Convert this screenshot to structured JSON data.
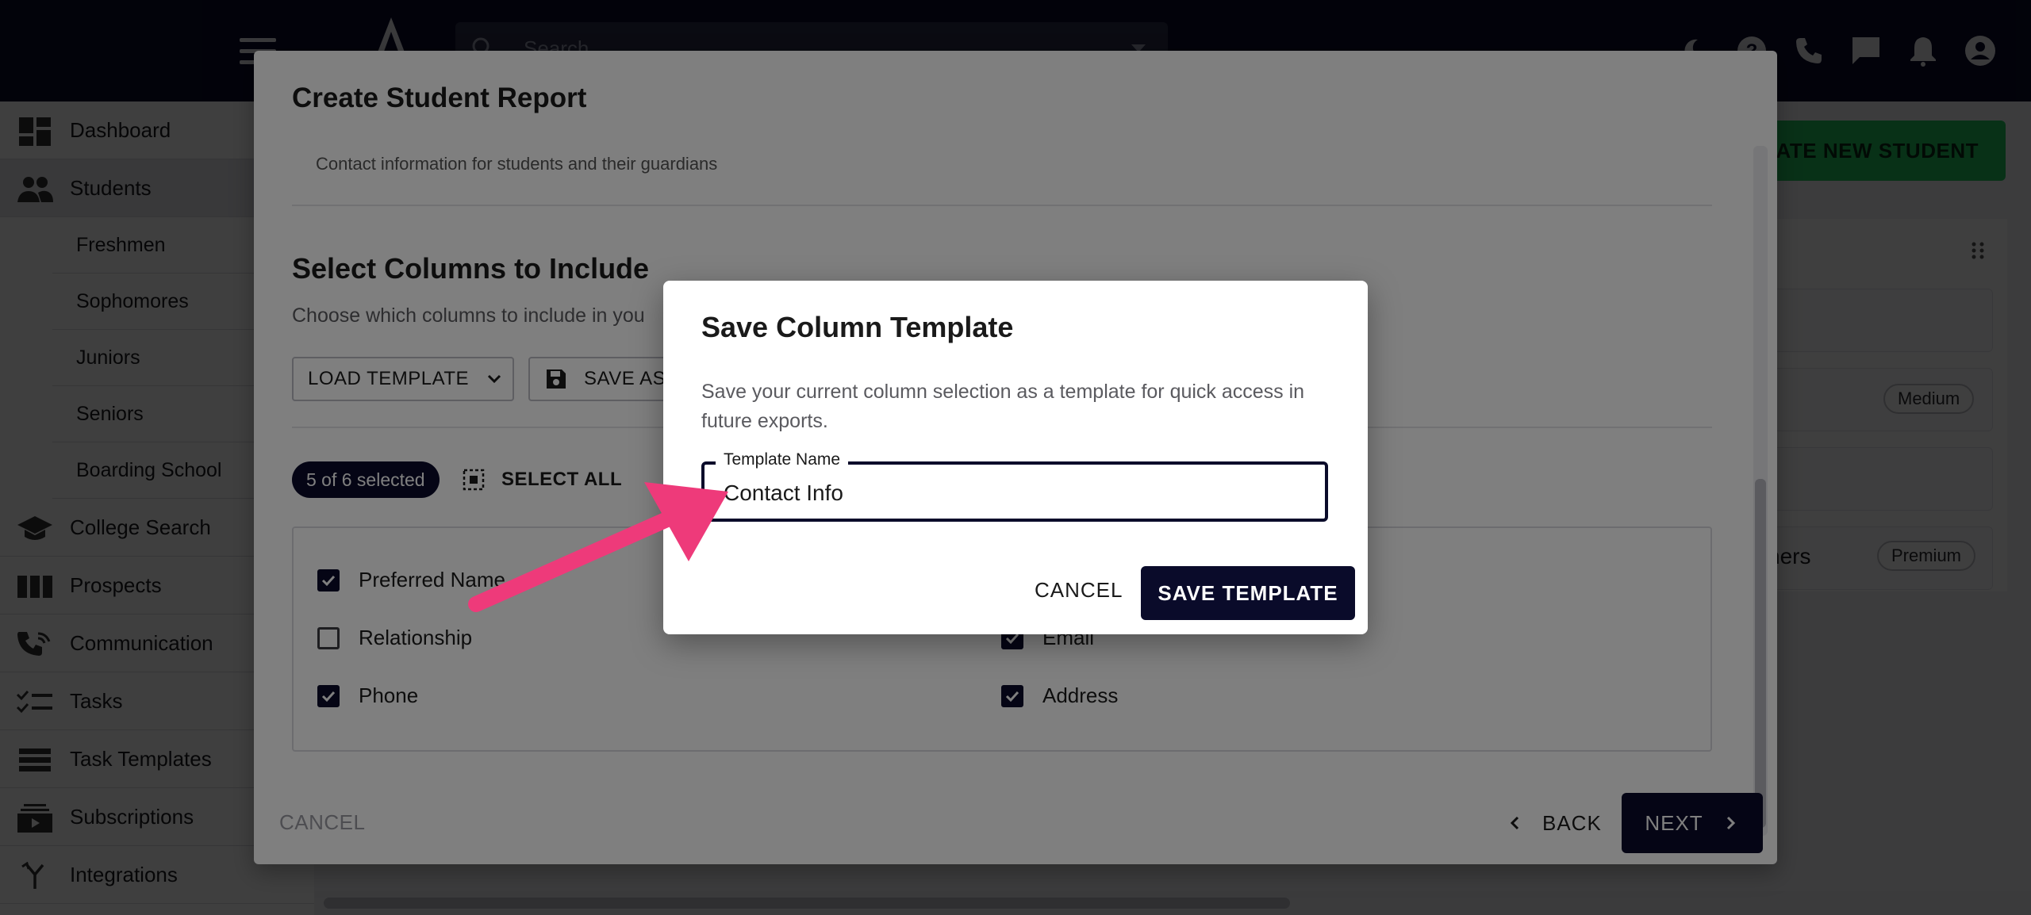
{
  "topbar": {
    "search_placeholder": "Search"
  },
  "sidebar": {
    "items": [
      {
        "label": "Dashboard",
        "icon": "dashboard-icon"
      },
      {
        "label": "Students",
        "icon": "people-icon",
        "active": true
      },
      {
        "label": "Freshmen"
      },
      {
        "label": "Sophomores"
      },
      {
        "label": "Juniors"
      },
      {
        "label": "Seniors"
      },
      {
        "label": "Boarding School"
      },
      {
        "label": "College Search",
        "icon": "graduation-cap-icon"
      },
      {
        "label": "Prospects",
        "icon": "columns-icon"
      },
      {
        "label": "Communication",
        "icon": "communication-icon"
      },
      {
        "label": "Tasks",
        "icon": "checklist-icon"
      },
      {
        "label": "Task Templates",
        "icon": "list-icon"
      },
      {
        "label": "Subscriptions",
        "icon": "subscriptions-icon"
      },
      {
        "label": "Integrations",
        "icon": "merge-icon"
      }
    ]
  },
  "background": {
    "create_button": "CREATE NEW STUDENT",
    "pill_medium": "Medium",
    "pill_premium": "Premium",
    "partial_text": "ners"
  },
  "report": {
    "title": "Create Student Report",
    "description": "Contact information for students and their guardians",
    "section_title": "Select Columns to Include",
    "section_sub": "Choose which columns to include in you",
    "load_template": "LOAD TEMPLATE",
    "save_as": "SAVE AS",
    "selected_count": "5 of 6 selected",
    "select_all": "SELECT ALL",
    "columns": [
      {
        "label": "Preferred Name",
        "checked": true
      },
      {
        "label": "Relationship",
        "checked": false
      },
      {
        "label": "Phone",
        "checked": true
      },
      {
        "label": "Email",
        "checked": true
      },
      {
        "label": "Address",
        "checked": true
      }
    ],
    "footer_cancel": "CANCEL",
    "footer_back": "BACK",
    "footer_next": "NEXT"
  },
  "dialog": {
    "title": "Save Column Template",
    "text": "Save your current column selection as a template for quick access in future exports.",
    "field_label": "Template Name",
    "field_value": "Contact Info",
    "cancel": "CANCEL",
    "save": "SAVE TEMPLATE"
  },
  "colors": {
    "navy": "#0a0b2a",
    "green": "#22c55e",
    "arrow": "#ee3a7a"
  }
}
